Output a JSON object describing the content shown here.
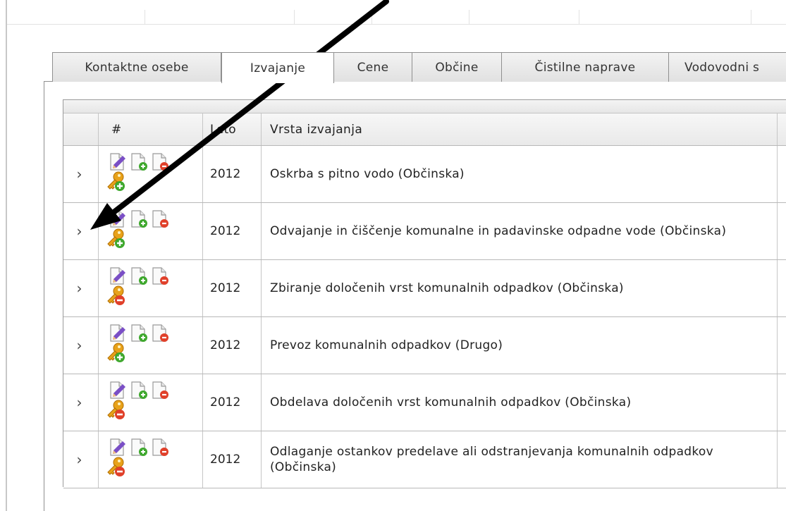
{
  "tabs": [
    {
      "label": "Kontaktne osebe",
      "active": false
    },
    {
      "label": "Izvajanje",
      "active": true
    },
    {
      "label": "Cene",
      "active": false
    },
    {
      "label": "Občine",
      "active": false
    },
    {
      "label": "Čistilne naprave",
      "active": false
    },
    {
      "label": "Vodovodni s",
      "active": false
    }
  ],
  "grid": {
    "headers": {
      "hash": "#",
      "year": "Leto",
      "type": "Vrsta izvajanja"
    },
    "rows": [
      {
        "year": "2012",
        "type": "Oskrba s pitno vodo (Občinska)",
        "key_badge": "add"
      },
      {
        "year": "2012",
        "type": "Odvajanje in čiščenje komunalne in padavinske odpadne vode (Občinska)",
        "key_badge": "add"
      },
      {
        "year": "2012",
        "type": "Zbiranje določenih vrst komunalnih odpadkov (Občinska)",
        "key_badge": "remove"
      },
      {
        "year": "2012",
        "type": "Prevoz komunalnih odpadkov (Drugo)",
        "key_badge": "add"
      },
      {
        "year": "2012",
        "type": "Obdelava določenih vrst komunalnih odpadkov (Občinska)",
        "key_badge": "remove"
      },
      {
        "year": "2012",
        "type": "Odlaganje ostankov predelave ali odstranjevanja komunalnih odpadkov (Občinska)",
        "key_badge": "remove"
      }
    ]
  },
  "icons": {
    "expander": "chevron-right-icon",
    "edit": "edit-document-icon",
    "add": "add-document-icon",
    "delete": "delete-document-icon",
    "key": "key-icon"
  },
  "colors": {
    "add_badge": "#3fa82e",
    "remove_badge": "#e0402a",
    "key": "#e8a21a",
    "pencil": "#7a4fc6"
  }
}
